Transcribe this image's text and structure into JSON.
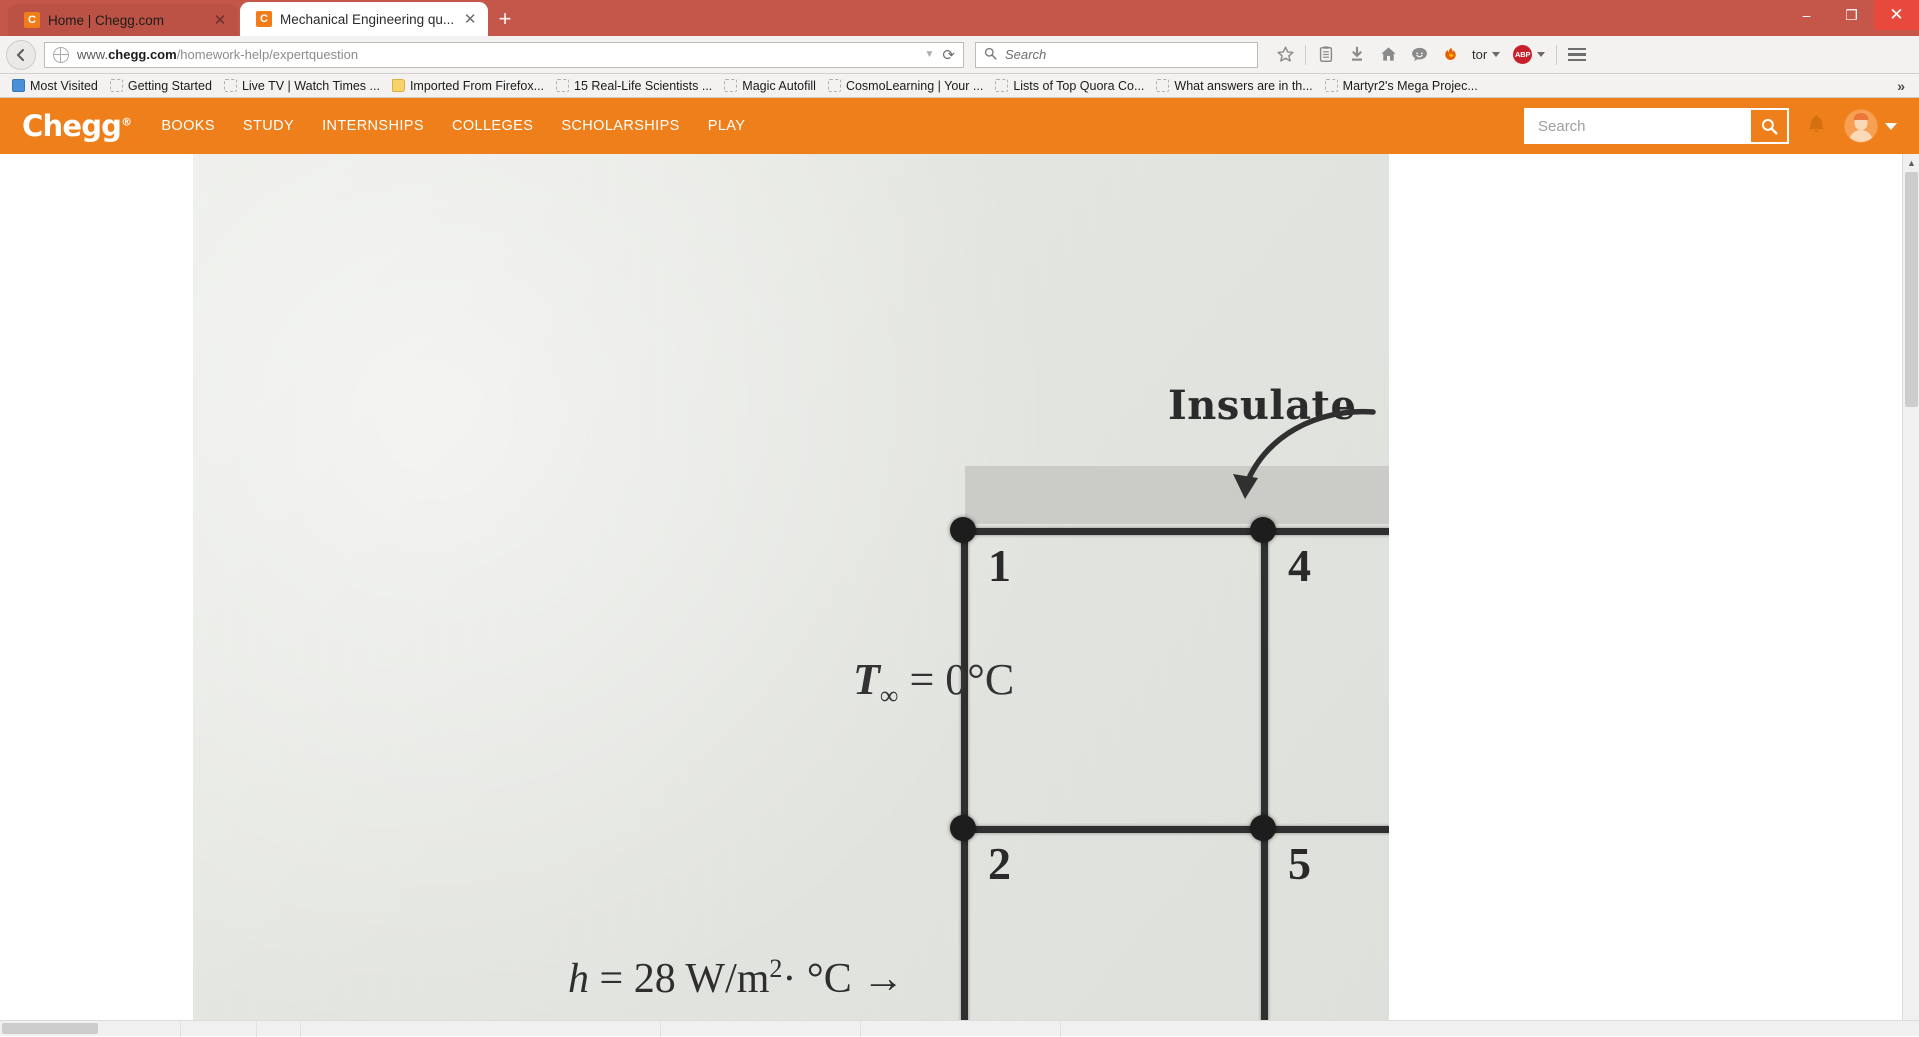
{
  "window": {
    "minimize_label": "–",
    "restore_label": "❐",
    "close_label": "✕"
  },
  "tabs": [
    {
      "favicon": "C",
      "title": "Home | Chegg.com",
      "close": "✕",
      "active": false
    },
    {
      "favicon": "C",
      "title": "Mechanical Engineering qu...",
      "close": "✕",
      "active": true
    }
  ],
  "new_tab_label": "+",
  "toolbar": {
    "back_label": "←",
    "url": {
      "prefix": "www.",
      "domain": "chegg.com",
      "path": "/homework-help/expertquestion",
      "dropdown_marker": "▼",
      "reload_marker": "⟳"
    },
    "search": {
      "placeholder": "Search",
      "icon": "🔍"
    },
    "icons": [
      {
        "name": "bookmark-star-icon",
        "glyph": "☆"
      },
      {
        "name": "reader-view-icon",
        "glyph": "Ὕ2"
      },
      {
        "name": "downloads-icon",
        "glyph": "⬇"
      },
      {
        "name": "home-icon",
        "glyph": "⌂"
      },
      {
        "name": "pocket-chat-icon",
        "glyph": "☻"
      },
      {
        "name": "firefox-sync-icon",
        "glyph": "🦊"
      }
    ],
    "tor_label": "tor",
    "abp_label": "ABP",
    "menu_label": "☰"
  },
  "bookmarks": {
    "items": [
      {
        "label": "Most Visited",
        "icon": "blue"
      },
      {
        "label": "Getting Started",
        "icon": "dashed"
      },
      {
        "label": "Live TV | Watch Times ...",
        "icon": "dashed"
      },
      {
        "label": "Imported From Firefox...",
        "icon": "folder"
      },
      {
        "label": "15 Real-Life Scientists ...",
        "icon": "dashed"
      },
      {
        "label": "Magic Autofill",
        "icon": "dashed"
      },
      {
        "label": "CosmoLearning | Your ...",
        "icon": "dashed"
      },
      {
        "label": "Lists of Top Quora Co...",
        "icon": "dashed"
      },
      {
        "label": "What answers are in th...",
        "icon": "dashed"
      },
      {
        "label": "Martyr2's Mega Projec...",
        "icon": "dashed"
      }
    ],
    "overflow_label": "»"
  },
  "chegg": {
    "brand": "Chegg",
    "brand_mark": "®",
    "accent_color": "#ee7f1a",
    "nav": [
      {
        "label": "BOOKS"
      },
      {
        "label": "STUDY"
      },
      {
        "label": "INTERNSHIPS"
      },
      {
        "label": "COLLEGES"
      },
      {
        "label": "SCHOLARSHIPS"
      },
      {
        "label": "PLAY"
      }
    ],
    "search_placeholder": "Search",
    "search_button_icon": "🔍",
    "bell_icon": "🔔",
    "account_caret": "▾"
  },
  "document_image": {
    "caption_insulated": "Insulate",
    "t_infinity": {
      "symbol": "T",
      "subscript": "∞",
      "equals": "=",
      "value": "0°C"
    },
    "convection": {
      "symbol": "h",
      "equals": "=",
      "value": "28 W/m",
      "exponent": "2",
      "units": "· °C",
      "arrow": "→"
    },
    "node_labels": [
      "1",
      "4",
      "2",
      "5"
    ]
  },
  "scroll": {
    "up_arrow": "▲",
    "down_arrow": "▼"
  }
}
